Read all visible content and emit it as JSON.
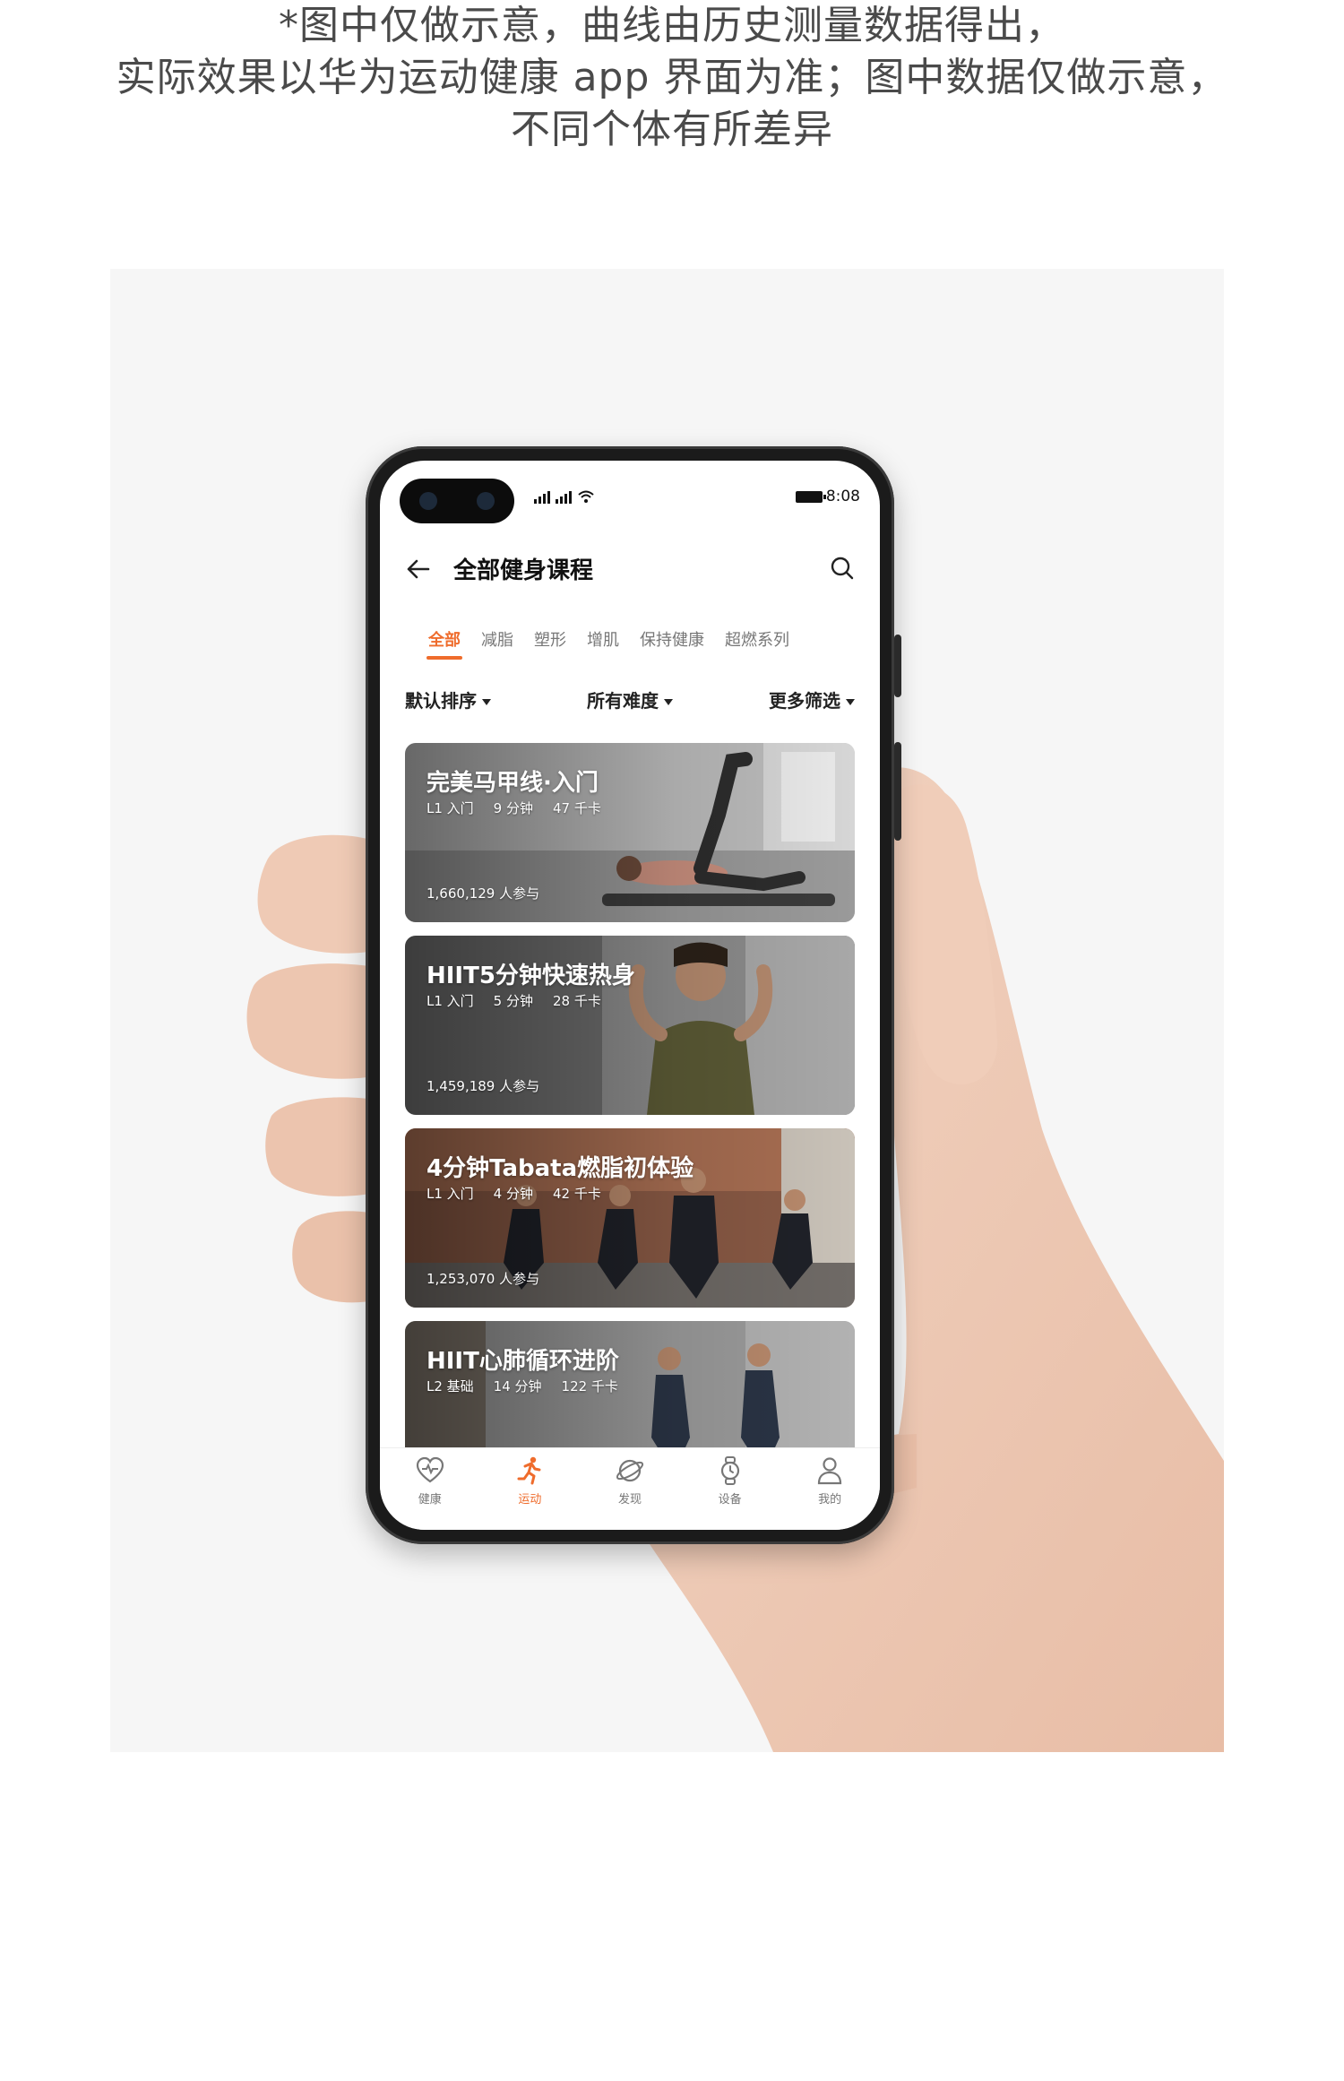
{
  "caption": {
    "line1": "*图中仅做示意，曲线由历史测量数据得出，",
    "line2": "实际效果以华为运动健康 app 界面为准；图中数据仅做示意，",
    "line3": "不同个体有所差异"
  },
  "status_bar": {
    "time": "8:08"
  },
  "header": {
    "title": "全部健身课程"
  },
  "tabs": [
    {
      "label": "全部",
      "active": true
    },
    {
      "label": "减脂",
      "active": false
    },
    {
      "label": "塑形",
      "active": false
    },
    {
      "label": "增肌",
      "active": false
    },
    {
      "label": "保持健康",
      "active": false
    },
    {
      "label": "超燃系列",
      "active": false
    }
  ],
  "filters": {
    "sort": "默认排序",
    "difficulty": "所有难度",
    "more": "更多筛选"
  },
  "courses": [
    {
      "title": "完美马甲线·入门",
      "level": "L1 入门",
      "duration": "9 分钟",
      "calories": "47 千卡",
      "participants": "1,660,129 人参与"
    },
    {
      "title": "HIIT5分钟快速热身",
      "level": "L1 入门",
      "duration": "5 分钟",
      "calories": "28 千卡",
      "participants": "1,459,189 人参与"
    },
    {
      "title": "4分钟Tabata燃脂初体验",
      "level": "L1 入门",
      "duration": "4 分钟",
      "calories": "42 千卡",
      "participants": "1,253,070 人参与"
    },
    {
      "title": "HIIT心肺循环进阶",
      "level": "L2 基础",
      "duration": "14 分钟",
      "calories": "122 千卡",
      "participants": ""
    }
  ],
  "bottom_nav": [
    {
      "label": "健康",
      "icon": "heart-icon",
      "active": false
    },
    {
      "label": "运动",
      "icon": "running-icon",
      "active": true
    },
    {
      "label": "发现",
      "icon": "planet-icon",
      "active": false
    },
    {
      "label": "设备",
      "icon": "watch-icon",
      "active": false
    },
    {
      "label": "我的",
      "icon": "person-icon",
      "active": false
    }
  ],
  "colors": {
    "accent": "#ef6c2c",
    "text": "#111111",
    "caption": "#4a4a4a"
  }
}
